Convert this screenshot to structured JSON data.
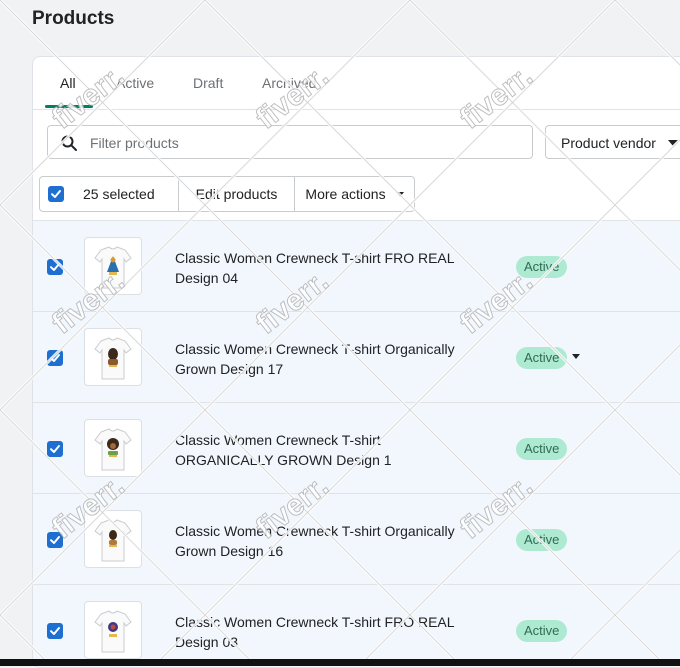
{
  "page": {
    "title": "Products"
  },
  "tabs": [
    {
      "label": "All",
      "active": true
    },
    {
      "label": "Active",
      "active": false
    },
    {
      "label": "Draft",
      "active": false
    },
    {
      "label": "Archived",
      "active": false
    }
  ],
  "filter": {
    "placeholder": "Filter products",
    "vendor_label": "Product vendor"
  },
  "bulk": {
    "selected_label": "25 selected",
    "edit_label": "Edit products",
    "more_label": "More actions"
  },
  "products": [
    {
      "title": "Classic Women Crewneck T-shirt FRO REAL Design 04",
      "status": "Active"
    },
    {
      "title": "Classic Women Crewneck T-shirt Organically Grown Design 17",
      "status": "Active"
    },
    {
      "title": "Classic Women Crewneck T-shirt ORGANICALLY GROWN Design 1",
      "status": "Active"
    },
    {
      "title": "Classic Women Crewneck T-shirt Organically Grown Design 16",
      "status": "Active"
    },
    {
      "title": "Classic Women Crewneck T-shirt FRO REAL Design 03",
      "status": "Active"
    }
  ],
  "watermark": "fiverr.",
  "colors": {
    "accent": "#008060",
    "checkbox": "#1f6fd1",
    "badge_bg": "#aee9d1",
    "row_selected": "#f2f7fe"
  }
}
